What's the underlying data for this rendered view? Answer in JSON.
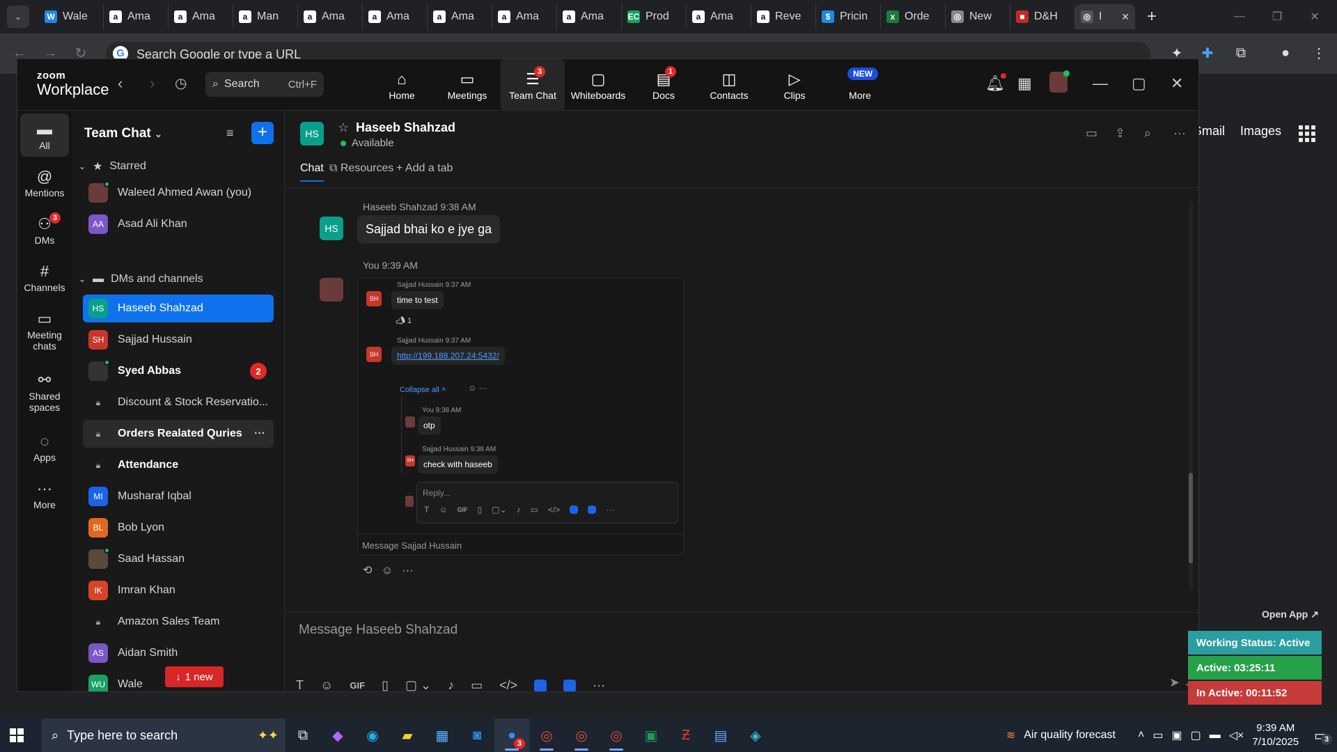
{
  "browser": {
    "tabs": [
      {
        "label": "Wale",
        "fav": "W",
        "color": "#1e88e5"
      },
      {
        "label": "Ama",
        "fav": "a",
        "color": "#ffffff"
      },
      {
        "label": "Ama",
        "fav": "a",
        "color": "#ffffff"
      },
      {
        "label": "Man",
        "fav": "a",
        "color": "#ffffff"
      },
      {
        "label": "Ama",
        "fav": "a",
        "color": "#ffffff"
      },
      {
        "label": "Ama",
        "fav": "a",
        "color": "#ffffff"
      },
      {
        "label": "Ama",
        "fav": "a",
        "color": "#ffffff"
      },
      {
        "label": "Ama",
        "fav": "a",
        "color": "#ffffff"
      },
      {
        "label": "Ama",
        "fav": "a",
        "color": "#ffffff"
      },
      {
        "label": "Prod",
        "fav": "EC",
        "color": "#1aa260"
      },
      {
        "label": "Ama",
        "fav": "a",
        "color": "#ffffff"
      },
      {
        "label": "Reve",
        "fav": "a",
        "color": "#ffffff"
      },
      {
        "label": "Pricin",
        "fav": "$",
        "color": "#1e88e5"
      },
      {
        "label": "Orde",
        "fav": "x",
        "color": "#1d7a3e"
      },
      {
        "label": "New",
        "fav": "◎",
        "color": "#888888"
      },
      {
        "label": "D&H",
        "fav": "■",
        "color": "#c62828"
      }
    ],
    "active_tab": "I",
    "omnibox_placeholder": "Search Google or type a URL",
    "google_links": [
      "Gmail",
      "Images"
    ]
  },
  "zoom": {
    "logo_top": "zoom",
    "logo_bottom": "Workplace",
    "search_label": "Search",
    "search_shortcut": "Ctrl+F",
    "nav": [
      {
        "label": "Home",
        "icon": "⌂"
      },
      {
        "label": "Meetings",
        "icon": "▭"
      },
      {
        "label": "Team Chat",
        "icon": "☰",
        "badge": "3"
      },
      {
        "label": "Whiteboards",
        "icon": "▢"
      },
      {
        "label": "Docs",
        "icon": "▤",
        "badge": "1"
      },
      {
        "label": "Contacts",
        "icon": "◫"
      },
      {
        "label": "Clips",
        "icon": "▷"
      },
      {
        "label": "More",
        "icon": "",
        "new": "NEW"
      }
    ],
    "rail": [
      {
        "label": "All",
        "icon": "▬"
      },
      {
        "label": "Mentions",
        "icon": "@"
      },
      {
        "label": "DMs",
        "icon": "⚇",
        "badge": "3"
      },
      {
        "label": "Channels",
        "icon": "#"
      },
      {
        "label": "Meeting chats",
        "icon": "▭"
      },
      {
        "label": "Shared spaces",
        "icon": "⚯"
      },
      {
        "label": "Apps",
        "icon": "◌"
      },
      {
        "label": "More",
        "icon": "···"
      }
    ],
    "list": {
      "title": "Team Chat",
      "starred_header": "Starred",
      "dms_header": "DMs and channels",
      "starred": [
        {
          "name": "Waleed Ahmed Awan (you)",
          "initials": "",
          "color": "#6b3b3b"
        },
        {
          "name": "Asad Ali Khan",
          "initials": "AA",
          "color": "#7b57c7"
        }
      ],
      "items": [
        {
          "name": "Haseeb Shahzad",
          "initials": "HS",
          "color": "#0a9f8a"
        },
        {
          "name": "Sajjad Hussain",
          "initials": "SH",
          "color": "#c7372b"
        },
        {
          "name": "Syed Abbas",
          "initials": "",
          "color": "#333333",
          "count": "2"
        },
        {
          "name": "Discount & Stock Reservatio...",
          "initials": "",
          "color": "#3a3a3a"
        },
        {
          "name": "Orders Realated Quries",
          "initials": "",
          "color": "#3a3a3a"
        },
        {
          "name": "Attendance",
          "initials": "",
          "color": "#3a3a3a"
        },
        {
          "name": "Musharaf Iqbal",
          "initials": "MI",
          "color": "#1b63e8"
        },
        {
          "name": "Bob Lyon",
          "initials": "BL",
          "color": "#e06a1b"
        },
        {
          "name": "Saad Hassan",
          "initials": "",
          "color": "#5a4a3a"
        },
        {
          "name": "Imran Khan",
          "initials": "IK",
          "color": "#d8432a"
        },
        {
          "name": "Amazon Sales Team",
          "initials": "",
          "color": "#3a3a3a"
        },
        {
          "name": "Aidan Smith",
          "initials": "AS",
          "color": "#7b57c7"
        },
        {
          "name": "Wale",
          "initials": "WU",
          "color": "#1aa260",
          "suffix": "an"
        }
      ],
      "new_pill": "1 new"
    },
    "chat": {
      "name": "Haseeb Shahzad",
      "initials": "HS",
      "status": "Available",
      "tabs": [
        "Chat",
        "Resources",
        "Add a tab"
      ],
      "messages": [
        {
          "sender": "Haseeb Shahzad",
          "time": "9:38 AM",
          "text": "Sajjad bhai ko e jye ga"
        },
        {
          "sender": "You",
          "time": "9:39 AM"
        }
      ],
      "thread": {
        "m1_meta": "Sajjad Hussain 9:37 AM",
        "m1_text": "time to test",
        "m1_reaction": "1",
        "m2_meta": "Sajjad Hussain 9:37 AM",
        "m2_link": "http://199.188.207.24:5432/",
        "collapse": "Collapse all",
        "r1_meta": "You 9:38 AM",
        "r1_text": "otp",
        "r2_meta": "Sajjad Hussain 9:38 AM",
        "r2_text": "check with haseeb",
        "reply_ph": "Reply...",
        "footer": "Message Sajjad Hussain",
        "av_initials": "SH"
      },
      "composer_ph": "Message Haseeb Shahzad"
    }
  },
  "widget": {
    "open_app": "Open App ↗",
    "working": "Working Status: Active",
    "active": "Active: 03:25:11",
    "inactive": "In Active: 00:11:52",
    "colors": {
      "working": "#2b9fa0",
      "active": "#27a24a",
      "inactive": "#c73a3a"
    }
  },
  "taskbar": {
    "search_ph": "Type here to search",
    "weather": "Air quality forecast",
    "time": "9:39 AM",
    "date": "7/10/2025",
    "notif_count": "3",
    "zoom_badge": "3"
  }
}
